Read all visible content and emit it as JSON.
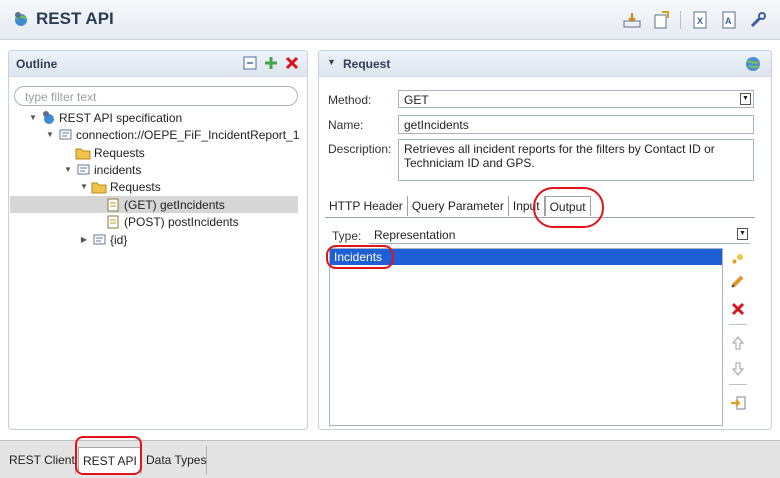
{
  "window": {
    "title": "REST API"
  },
  "outline": {
    "title": "Outline",
    "filter_placeholder": "type filter text",
    "tree": {
      "root": "REST API specification",
      "connection": "connection://OEPE_FiF_IncidentReport_1",
      "requests": "Requests",
      "incidents": "incidents",
      "inc_requests": "Requests",
      "get_item": "(GET) getIncidents",
      "post_item": "(POST) postIncidents",
      "id_item": "{id}"
    }
  },
  "request": {
    "title": "Request",
    "method_label": "Method:",
    "method_value": "GET",
    "name_label": "Name:",
    "name_value": "getIncidents",
    "description_label": "Description:",
    "description_value": "Retrieves all incident reports for the filters by Contact ID or Techniciam ID and GPS.",
    "tabs": [
      "HTTP Header",
      "Query Parameter",
      "Input",
      "Output"
    ],
    "active_tab": "Output",
    "type_label": "Type:",
    "type_value": "Representation",
    "list_items": [
      "Incidents"
    ]
  },
  "bottom_tabs": [
    "REST Client",
    "REST API",
    "Data Types"
  ],
  "active_bottom_tab": "REST API",
  "colors": {
    "selection": "#1e5fd6",
    "annotation": "#e1141a",
    "delete": "#d8141a"
  },
  "icons": {
    "toolbar": [
      "import-icon",
      "export-icon",
      "xml-icon",
      "text-icon",
      "wrench-icon"
    ],
    "outline_header": [
      "collapse-all-icon",
      "add-icon",
      "delete-icon"
    ],
    "side_tools": [
      "add-item-icon",
      "edit-icon",
      "remove-icon",
      "move-up-icon",
      "move-down-icon",
      "import-icon"
    ]
  }
}
